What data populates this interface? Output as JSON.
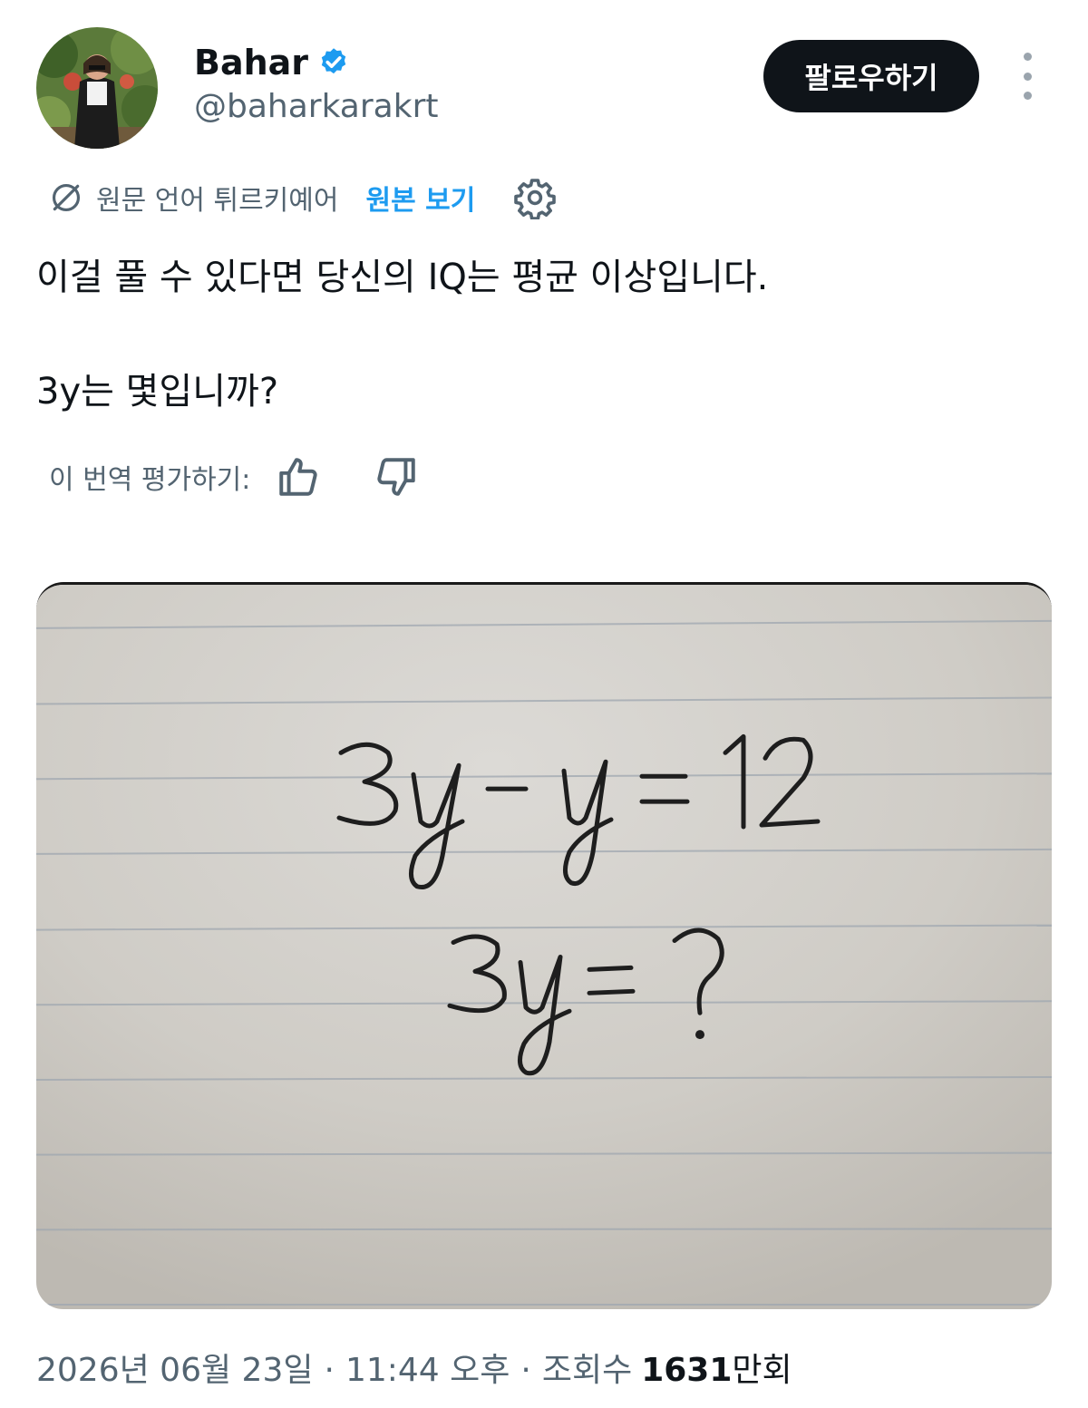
{
  "user": {
    "display_name": "Bahar",
    "handle": "@baharkarakrt",
    "verified": true,
    "verified_color": "#1d9bf0"
  },
  "header": {
    "follow_label": "팔로우하기",
    "more_icon": "more-vertical-icon"
  },
  "translation": {
    "label": "원문 언어 튀르키예어",
    "view_original": "원본 보기",
    "icon": "translate-icon",
    "settings_icon": "gear-icon"
  },
  "tweet": {
    "line1": "이걸 풀 수 있다면 당신의 IQ는 평균 이상입니다.",
    "line2": "3y는 몇입니까?"
  },
  "rating": {
    "label": "이 번역 평가하기:",
    "up_icon": "thumbs-up-icon",
    "down_icon": "thumbs-down-icon"
  },
  "media": {
    "equation1": "3y - y = 12",
    "equation2": "3y = ?"
  },
  "meta": {
    "date": "2026년 06월 23일",
    "time": "11:44 오후",
    "views_label": "조회수",
    "views_count": "1631",
    "views_unit": "만회"
  },
  "colors": {
    "accent": "#1d9bf0",
    "text_primary": "#0f1419",
    "text_secondary": "#536471",
    "button_bg": "#0f1419"
  }
}
